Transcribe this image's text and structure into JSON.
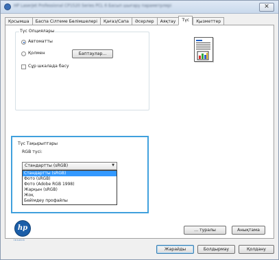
{
  "window": {
    "title": "HP LaserJet Professional CP1520 Series PCL 6 Басып шығару параметрлері",
    "close_label": "✕"
  },
  "tabs": [
    {
      "label": "Қосымша",
      "active": false
    },
    {
      "label": "Баспа Сілтеме Бөлімшелері",
      "active": false
    },
    {
      "label": "Қағаз/Сапа",
      "active": false
    },
    {
      "label": "Әсерлер",
      "active": false
    },
    {
      "label": "Аяқтау",
      "active": false
    },
    {
      "label": "Түс",
      "active": true
    },
    {
      "label": "Қызметтер",
      "active": false
    }
  ],
  "color_options": {
    "legend": "Түс Опциялары",
    "automatic_label": "Автоматты",
    "manual_label": "Қолмен",
    "settings_button": "Баптаулар...",
    "grayscale_label": "Сұр шкалада басу"
  },
  "color_themes": {
    "legend": "Түс Тақырыптары",
    "rgb_label": "RGB түсі:",
    "selected_value": "Стандартты (sRGB)",
    "options": [
      "Стандартты (sRGB)",
      "Фото (sRGB)",
      "Фото (Adobe RGB 1998)",
      "Жарқын (sRGB)",
      "Жоқ",
      "Бейімдеу профайлы"
    ]
  },
  "brand": {
    "logo_text": "hp",
    "tagline": "invent"
  },
  "footer": {
    "about_button": "... туралы",
    "help_button": "Анықтама",
    "ok_button": "Жарайды",
    "cancel_button": "Болдырмау",
    "apply_button": "Қолдану"
  },
  "colors": {
    "accent_border": "#3fa0dd",
    "selection": "#3399ff",
    "hp_blue": "#1b5ea8"
  }
}
